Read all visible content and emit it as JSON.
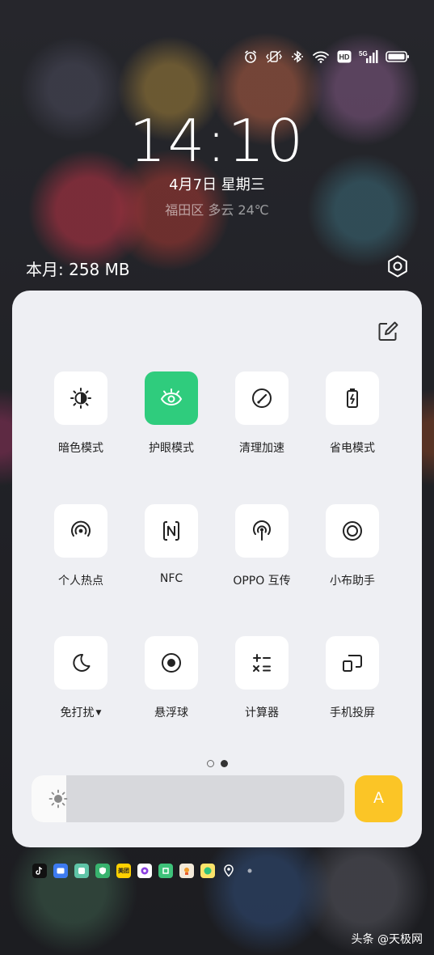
{
  "lockscreen": {
    "time": "14:10",
    "date": "4月7日  星期三",
    "weather": "福田区 多云 24℃",
    "data_usage": "本月: 258 MB"
  },
  "status_icons": [
    "alarm-icon",
    "vibrate-icon",
    "bluetooth-icon",
    "wifi-icon",
    "hd-icon",
    "5g-signal-icon",
    "battery-icon"
  ],
  "status_bar": {
    "hd_label": "HD",
    "network_label": "5G"
  },
  "quick_settings": {
    "tiles": [
      {
        "label": "暗色模式",
        "icon": "dark-mode-icon",
        "active": false
      },
      {
        "label": "护眼模式",
        "icon": "eye-icon",
        "active": true
      },
      {
        "label": "清理加速",
        "icon": "speed-icon",
        "active": false
      },
      {
        "label": "省电模式",
        "icon": "battery-saver-icon",
        "active": false
      },
      {
        "label": "个人热点",
        "icon": "hotspot-icon",
        "active": false
      },
      {
        "label": "NFC",
        "icon": "nfc-icon",
        "active": false
      },
      {
        "label": "OPPO 互传",
        "icon": "share-icon",
        "active": false
      },
      {
        "label": "小布助手",
        "icon": "assistant-icon",
        "active": false
      },
      {
        "label": "免打扰",
        "icon": "moon-icon",
        "active": false,
        "has_caret": true
      },
      {
        "label": "悬浮球",
        "icon": "float-ball-icon",
        "active": false
      },
      {
        "label": "计算器",
        "icon": "calculator-icon",
        "active": false
      },
      {
        "label": "手机投屏",
        "icon": "cast-icon",
        "active": false
      }
    ],
    "page_count": 2,
    "current_page": 2,
    "brightness_level": 0.11,
    "auto_brightness_label": "A"
  },
  "notification_icons": [
    "tiktok-icon",
    "message-icon",
    "gallery-icon",
    "security-icon",
    "meituan-icon",
    "music-icon",
    "app-icon",
    "taobao-icon",
    "qq-music-icon",
    "location-icon",
    "more-dot-icon"
  ],
  "notification_labels": {
    "meituan": "美团"
  },
  "watermark": "头条 @天极网",
  "colors": {
    "active_tile": "#2fcc7d",
    "auto_button": "#fbc526",
    "panel_bg": "#eeeff3"
  }
}
